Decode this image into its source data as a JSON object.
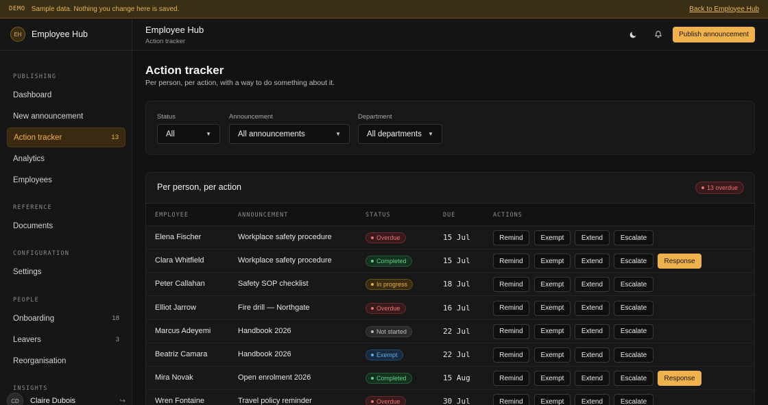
{
  "demo": {
    "tag": "DEMO",
    "message": "Sample data. Nothing you change here is saved.",
    "back_link": "Back to Employee Hub"
  },
  "sidebar": {
    "logo": "EH",
    "brand": "Employee Hub",
    "sections": [
      {
        "title": "PUBLISHING"
      },
      {
        "title": "REFERENCE"
      },
      {
        "title": "CONFIGURATION"
      },
      {
        "title": "PEOPLE"
      },
      {
        "title": "INSIGHTS"
      }
    ],
    "items": [
      {
        "label": "Dashboard",
        "count": ""
      },
      {
        "label": "New announcement",
        "count": ""
      },
      {
        "label": "Action tracker",
        "count": "13"
      },
      {
        "label": "Analytics",
        "count": ""
      },
      {
        "label": "Employees",
        "count": ""
      },
      {
        "label": "Documents",
        "count": ""
      },
      {
        "label": "Settings",
        "count": ""
      },
      {
        "label": "Onboarding",
        "count": "18"
      },
      {
        "label": "Leavers",
        "count": "3"
      },
      {
        "label": "Reorganisation",
        "count": ""
      }
    ],
    "user": {
      "initials": "CD",
      "name": "Claire Dubois"
    }
  },
  "topbar": {
    "title": "Employee Hub",
    "subtitle": "Action tracker",
    "publish_label": "Publish announcement"
  },
  "page": {
    "title": "Action tracker",
    "subtitle": "Per person, per action, with a way to do something about it."
  },
  "filters": {
    "status": {
      "label": "Status",
      "value": "All"
    },
    "announcement": {
      "label": "Announcement",
      "value": "All announcements"
    },
    "department": {
      "label": "Department",
      "value": "All departments"
    }
  },
  "table": {
    "title": "Per person, per action",
    "overdue_badge": "13 overdue",
    "columns": [
      "EMPLOYEE",
      "ANNOUNCEMENT",
      "STATUS",
      "DUE",
      "ACTIONS"
    ],
    "action_labels": {
      "remind": "Remind",
      "exempt": "Exempt",
      "extend": "Extend",
      "escalate": "Escalate",
      "response": "Response"
    },
    "rows": [
      {
        "employee": "Elena Fischer",
        "announcement": "Workplace safety procedure",
        "status": "Overdue",
        "due": "15 Jul"
      },
      {
        "employee": "Clara Whitfield",
        "announcement": "Workplace safety procedure",
        "status": "Completed",
        "due": "15 Jul"
      },
      {
        "employee": "Peter Callahan",
        "announcement": "Safety SOP checklist",
        "status": "In progress",
        "due": "18 Jul"
      },
      {
        "employee": "Elliot Jarrow",
        "announcement": "Fire drill — Northgate",
        "status": "Overdue",
        "due": "16 Jul"
      },
      {
        "employee": "Marcus Adeyemi",
        "announcement": "Handbook 2026",
        "status": "Not started",
        "due": "22 Jul"
      },
      {
        "employee": "Beatriz Camara",
        "announcement": "Handbook 2026",
        "status": "Exempt",
        "due": "22 Jul"
      },
      {
        "employee": "Mira Novak",
        "announcement": "Open enrolment 2026",
        "status": "Completed",
        "due": "15 Aug"
      },
      {
        "employee": "Wren Fontaine",
        "announcement": "Travel policy reminder",
        "status": "Overdue",
        "due": "30 Jul"
      }
    ]
  },
  "colors": {
    "accent": "#f0b24c",
    "overdue": "#e57373",
    "completed": "#5fd08a",
    "in_progress": "#e8b24c",
    "exempt": "#6aa8ea"
  }
}
